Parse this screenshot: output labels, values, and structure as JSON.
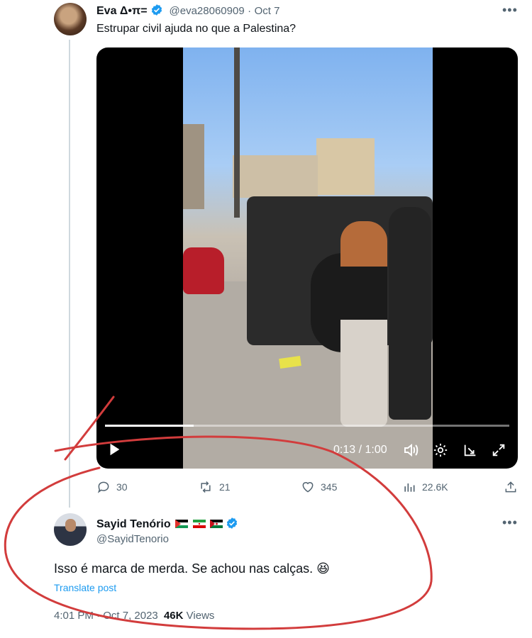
{
  "tweet1": {
    "name": "Eva Δ•π=",
    "handle": "@eva28060909",
    "separator": "·",
    "date": "Oct 7",
    "text": "Estrupar civil ajuda no que a Palestina?",
    "more_icon": "more-horizontal-icon",
    "video": {
      "current_time": "0:13",
      "divider": "/",
      "duration": "1:00",
      "progress": 0.22
    },
    "actions": {
      "replies": "30",
      "reposts": "21",
      "likes": "345",
      "views": "22.6K"
    }
  },
  "tweet2": {
    "name": "Sayid Tenório",
    "handle": "@SayidTenorio",
    "text": "Isso é marca de merda. Se achou nas calças. 😆",
    "translate": "Translate post",
    "time": "4:01 PM",
    "dot": "·",
    "date": "Oct 7, 2023",
    "views_count": "46K",
    "views_label": "Views"
  },
  "colors": {
    "text": "#0f1419",
    "muted": "#536471",
    "link": "#1d9bf0",
    "verified": "#1d9bf0",
    "annotation": "#d23c3c"
  }
}
